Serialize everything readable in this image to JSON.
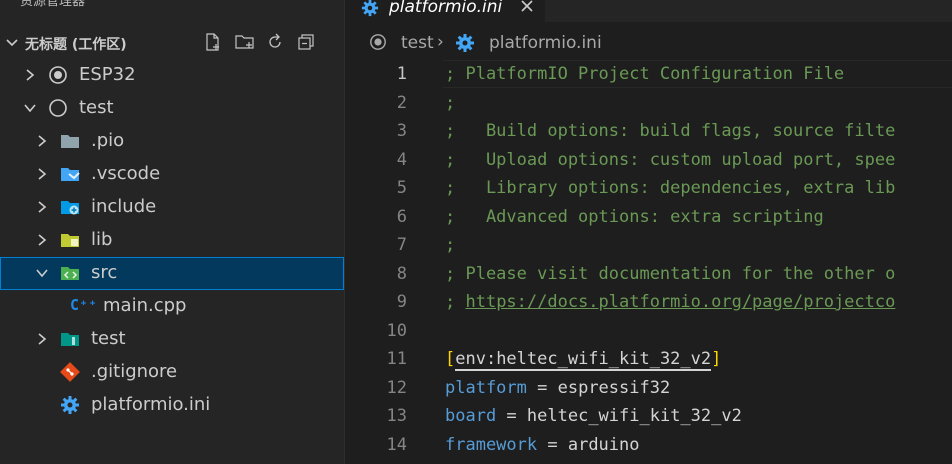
{
  "explorer": {
    "title": "资源管理器",
    "more_icon": "ellipsis-icon",
    "workspace": {
      "label": "无标题 (工作区)",
      "actions": [
        "new-file-icon",
        "new-folder-icon",
        "refresh-icon",
        "collapse-all-icon"
      ]
    },
    "tree": [
      {
        "label": "ESP32",
        "icon": "platformio-project-icon"
      },
      {
        "label": "test",
        "icon": "circle-project-icon"
      },
      {
        "label": ".pio",
        "icon": "folder-icon"
      },
      {
        "label": ".vscode",
        "icon": "vscode-folder-icon"
      },
      {
        "label": "include",
        "icon": "include-folder-icon"
      },
      {
        "label": "lib",
        "icon": "lib-folder-icon"
      },
      {
        "label": "src",
        "icon": "src-folder-icon",
        "selected": true
      },
      {
        "label": "main.cpp",
        "icon": "cpp-file-icon"
      },
      {
        "label": "test",
        "icon": "test-folder-icon"
      },
      {
        "label": ".gitignore",
        "icon": "git-icon"
      },
      {
        "label": "platformio.ini",
        "icon": "gear-icon"
      }
    ]
  },
  "tab": {
    "label": "platformio.ini",
    "icon": "gear-icon",
    "close_icon": "close-icon"
  },
  "breadcrumb": {
    "project": "test",
    "separator": "›",
    "file": "platformio.ini"
  },
  "editor": {
    "current_line": 1,
    "lines": [
      {
        "n": "1",
        "text": "; PlatformIO Project Configuration File"
      },
      {
        "n": "2",
        "text": ";"
      },
      {
        "n": "3",
        "text": ";   Build options: build flags, source filte"
      },
      {
        "n": "4",
        "text": ";   Upload options: custom upload port, spee"
      },
      {
        "n": "5",
        "text": ";   Library options: dependencies, extra lib"
      },
      {
        "n": "6",
        "text": ";   Advanced options: extra scripting"
      },
      {
        "n": "7",
        "text": ";"
      },
      {
        "n": "8",
        "text": "; Please visit documentation for the other o"
      },
      {
        "n": "9",
        "prefix": "; ",
        "link": "https://docs.platformio.org/page/projectco"
      },
      {
        "n": "10",
        "text": ""
      },
      {
        "n": "11",
        "open": "[",
        "section": "env:heltec_wifi_kit_32_v2",
        "close": "]"
      },
      {
        "n": "12",
        "key": "platform",
        "eq": " = ",
        "value": "espressif32"
      },
      {
        "n": "13",
        "key": "board",
        "eq": " = ",
        "value": "heltec_wifi_kit_32_v2"
      },
      {
        "n": "14",
        "key": "framework",
        "eq": " = ",
        "value": "arduino"
      }
    ]
  },
  "colors": {
    "comment": "#6a9955",
    "key": "#569cd6",
    "bracket": "#ffd700",
    "selection": "#04395e",
    "focus": "#007fd4"
  }
}
